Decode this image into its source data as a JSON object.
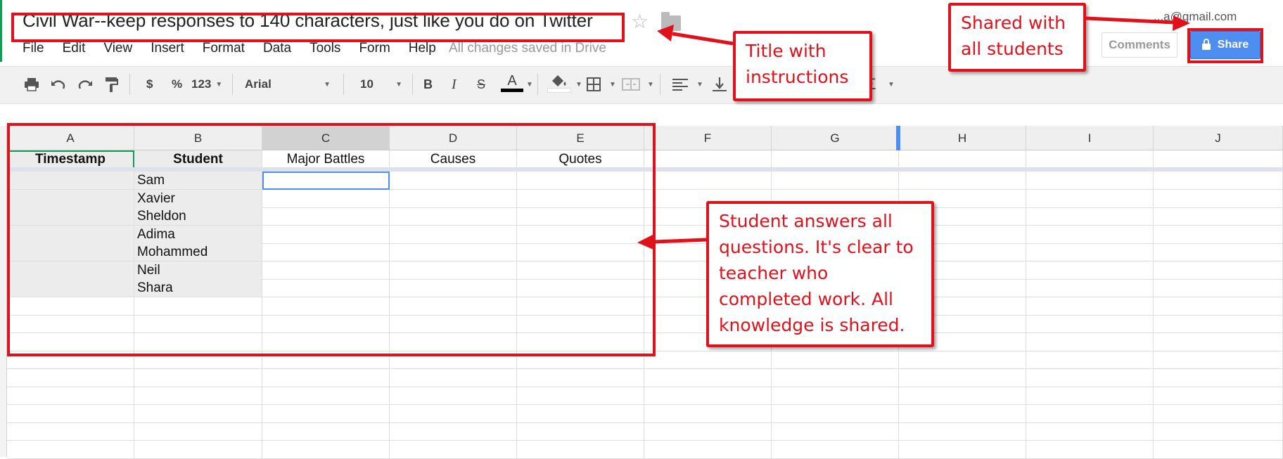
{
  "title": "Civil War--keep responses to 140 characters, just like you do on Twitter",
  "account": "...a@gmail.com",
  "menu": [
    "File",
    "Edit",
    "View",
    "Insert",
    "Format",
    "Data",
    "Tools",
    "Form",
    "Help"
  ],
  "save_status": "All changes saved in Drive",
  "buttons": {
    "comments": "Comments",
    "share": "Share"
  },
  "toolbar": {
    "currency": "$",
    "percent": "%",
    "more_formats": "123",
    "font": "Arial",
    "font_size": "10",
    "bold": "B",
    "italic": "I",
    "strikethrough": "S",
    "text_color": "A",
    "functions": "Σ"
  },
  "columns": [
    "A",
    "B",
    "C",
    "D",
    "E",
    "F",
    "G",
    "H",
    "I",
    "J"
  ],
  "selected_column": "C",
  "headers": [
    "Timestamp",
    "Student",
    "Major Battles",
    "Causes",
    "Quotes"
  ],
  "students": [
    "Sam",
    "Xavier",
    "Sheldon",
    "Adima",
    "Mohammed",
    "Neil",
    "Shara"
  ],
  "callouts": {
    "title_note": "Title with instructions",
    "share_note": "Shared with all students",
    "grid_note": "Student answers all questions. It's clear to teacher who completed work. All knowledge is shared."
  },
  "colors": {
    "annotation": "#e0111b",
    "share_button": "#4d8ef0",
    "selection": "#4d8ef0"
  }
}
